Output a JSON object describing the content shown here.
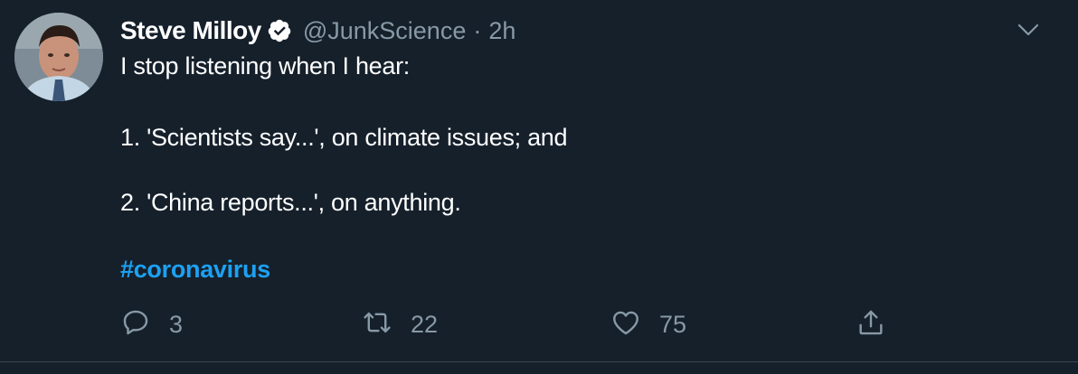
{
  "tweet": {
    "author_name": "Steve Milloy",
    "handle": "@JunkScience",
    "separator": "·",
    "time": "2h",
    "lines": [
      "I stop listening when I hear:",
      "1. 'Scientists say...', on climate issues; and",
      "2. 'China reports...', on anything."
    ],
    "hashtag": "#coronavirus"
  },
  "actions": {
    "reply_count": "3",
    "retweet_count": "22",
    "like_count": "75"
  },
  "colors": {
    "background": "#15202b",
    "secondary_text": "#8899a6",
    "link": "#1da1f2",
    "verified_badge": "#ffffff"
  },
  "icons": [
    "verified-badge-icon",
    "chevron-down-icon",
    "reply-icon",
    "retweet-icon",
    "like-icon",
    "share-icon"
  ]
}
